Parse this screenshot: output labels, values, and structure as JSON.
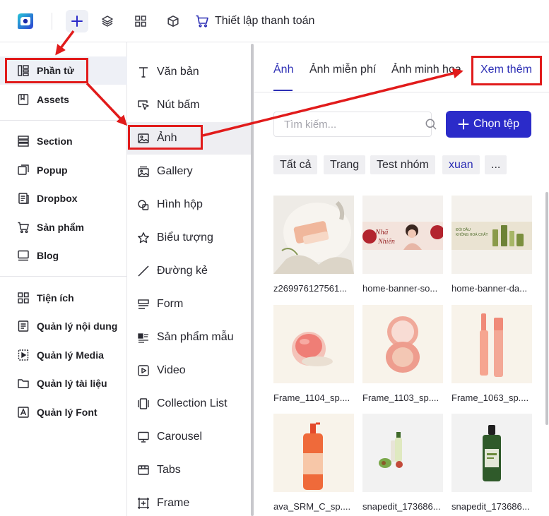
{
  "topbar": {
    "checkout_label": "Thiết lập thanh toán"
  },
  "sidebar": {
    "items": [
      {
        "label": "Phần tử",
        "icon": "elements-icon"
      },
      {
        "label": "Assets",
        "icon": "bookmark-icon"
      },
      {
        "label": "Section",
        "icon": "section-icon"
      },
      {
        "label": "Popup",
        "icon": "popup-icon"
      },
      {
        "label": "Dropbox",
        "icon": "dropbox-icon"
      },
      {
        "label": "Sản phẩm",
        "icon": "cart-icon"
      },
      {
        "label": "Blog",
        "icon": "blog-icon"
      },
      {
        "label": "Tiện ích",
        "icon": "grid-icon"
      },
      {
        "label": "Quản lý nội dung",
        "icon": "content-icon"
      },
      {
        "label": "Quản lý Media",
        "icon": "media-icon"
      },
      {
        "label": "Quản lý tài liệu",
        "icon": "folder-icon"
      },
      {
        "label": "Quản lý Font",
        "icon": "font-icon"
      }
    ]
  },
  "elements": {
    "items": [
      {
        "label": "Văn bản",
        "icon": "text-icon"
      },
      {
        "label": "Nút bấm",
        "icon": "cursor-icon"
      },
      {
        "label": "Ảnh",
        "icon": "image-icon"
      },
      {
        "label": "Gallery",
        "icon": "gallery-icon"
      },
      {
        "label": "Hình hộp",
        "icon": "shape-icon"
      },
      {
        "label": "Biểu tượng",
        "icon": "star-icon"
      },
      {
        "label": "Đường kẻ",
        "icon": "line-icon"
      },
      {
        "label": "Form",
        "icon": "form-icon"
      },
      {
        "label": "Sản phẩm mẫu",
        "icon": "product-icon"
      },
      {
        "label": "Video",
        "icon": "video-icon"
      },
      {
        "label": "Collection List",
        "icon": "collection-icon"
      },
      {
        "label": "Carousel",
        "icon": "carousel-icon"
      },
      {
        "label": "Tabs",
        "icon": "tabs-icon"
      },
      {
        "label": "Frame",
        "icon": "frame-icon"
      }
    ]
  },
  "panel": {
    "tabs": [
      "Ảnh",
      "Ảnh miễn phí",
      "Ảnh minh họa"
    ],
    "more_label": "Xem thêm",
    "search_placeholder": "Tìm kiếm...",
    "upload_label": "Chọn tệp",
    "chips": [
      "Tất cả",
      "Trang",
      "Test nhóm",
      "xuan",
      "..."
    ],
    "images": [
      {
        "caption": "z269976127561..."
      },
      {
        "caption": "home-banner-so..."
      },
      {
        "caption": "home-banner-da..."
      },
      {
        "caption": "Frame_1104_sp...."
      },
      {
        "caption": "Frame_1103_sp...."
      },
      {
        "caption": "Frame_1063_sp...."
      },
      {
        "caption": "ava_SRM_C_sp...."
      },
      {
        "caption": "snapedit_173686..."
      },
      {
        "caption": "snapedit_173686..."
      }
    ]
  },
  "colors": {
    "accent": "#2b2bc9",
    "annotation": "#e11b1b",
    "active_bg": "#eef0f6"
  }
}
